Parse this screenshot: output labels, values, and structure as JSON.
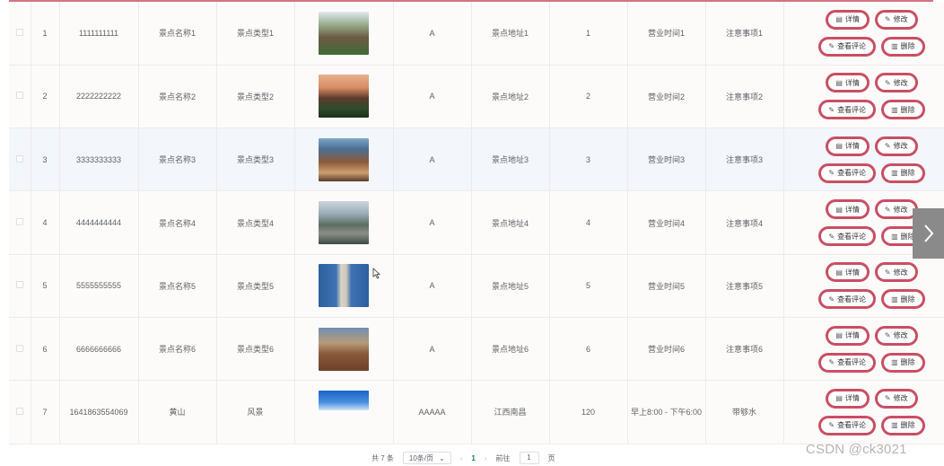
{
  "rows": [
    {
      "index": "1",
      "code": "1111111111",
      "name": "景点名称1",
      "type": "景点类型1",
      "level": "A",
      "address": "景点地址1",
      "num": "1",
      "hours": "营业时间1",
      "notes": "注意事项1",
      "thumb": "mountain-scenery"
    },
    {
      "index": "2",
      "code": "2222222222",
      "name": "景点名称2",
      "type": "景点类型2",
      "level": "A",
      "address": "景点地址2",
      "num": "2",
      "hours": "营业时间2",
      "notes": "注意事项2",
      "thumb": "pavilion-sunset"
    },
    {
      "index": "3",
      "code": "3333333333",
      "name": "景点名称3",
      "type": "景点类型3",
      "level": "A",
      "address": "景点地址3",
      "num": "3",
      "hours": "营业时间3",
      "notes": "注意事项3",
      "thumb": "old-town-street"
    },
    {
      "index": "4",
      "code": "4444444444",
      "name": "景点名称4",
      "type": "景点类型4",
      "level": "A",
      "address": "景点地址4",
      "num": "4",
      "hours": "营业时间4",
      "notes": "注意事项4",
      "thumb": "castle-lake"
    },
    {
      "index": "5",
      "code": "5555555555",
      "name": "景点名称5",
      "type": "景点类型5",
      "level": "A",
      "address": "景点地址5",
      "num": "5",
      "hours": "营业时间5",
      "notes": "注意事项5",
      "thumb": "leaning-tower"
    },
    {
      "index": "6",
      "code": "6666666666",
      "name": "景点名称6",
      "type": "景点类型6",
      "level": "A",
      "address": "景点地址6",
      "num": "6",
      "hours": "营业时间6",
      "notes": "注意事项6",
      "thumb": "rock-pillar"
    },
    {
      "index": "7",
      "code": "1641863554069",
      "name": "黄山",
      "type": "风景",
      "level": "AAAAA",
      "address": "江西南昌",
      "num": "120",
      "hours": "早上8:00 - 下午6:00",
      "notes": "带够水",
      "thumb": "blue-sky"
    }
  ],
  "ops": {
    "detail": "详情",
    "edit": "修改",
    "comments": "查看评论",
    "delete": "删除"
  },
  "pagination": {
    "total": "共 7 条",
    "page_size": "10条/页",
    "current": "1",
    "goto_prefix": "前往",
    "goto_value": "1",
    "goto_suffix": "页"
  },
  "watermark": "CSDN @ck3021",
  "colors": {
    "accent": "#c94f64",
    "header_line": "#d4757f",
    "highlight_row": "#f3f6fb",
    "current_page": "#1e7f56"
  }
}
